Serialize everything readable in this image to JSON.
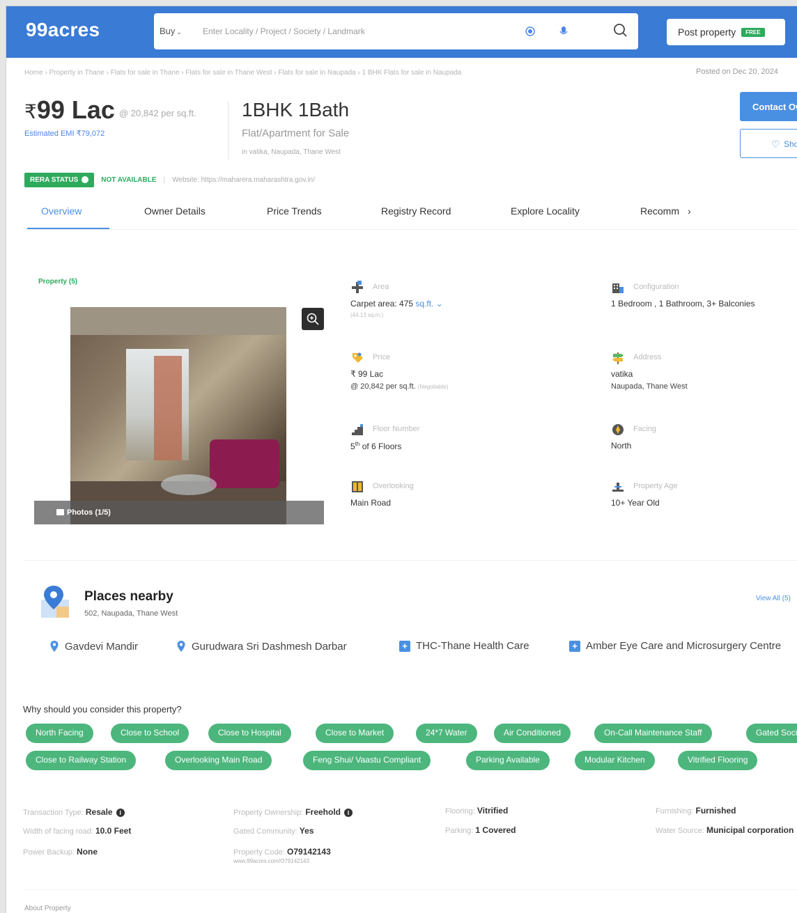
{
  "header": {
    "logo": "99acres",
    "buy_label": "Buy",
    "search_placeholder": "Enter Locality / Project / Society / Landmark",
    "post_property": "Post property",
    "free_badge": "FREE"
  },
  "breadcrumb": "Home › Property in Thane › Flats for sale in Thane › Flats for sale in Thane West › Flats for sale in Naupada › 1 BHK Flats for sale in Naupada",
  "posted_on": "Posted on Dec 20, 2024",
  "listing": {
    "price_symbol": "₹",
    "price": "99 Lac",
    "per_sqft": "@ 20,842 per sq.ft.",
    "emi": "Estimated EMI ₹79,072",
    "bhk": "1BHK 1Bath",
    "type": "Flat/Apartment for Sale",
    "location": "in vatika, Naupada, Thane West",
    "contact_btn": "Contact Owner",
    "shortlist_btn": "Shortlist"
  },
  "rera": {
    "badge": "RERA STATUS",
    "status": "NOT AVAILABLE",
    "separator": "|",
    "website": "Website: https://maharera.maharashtra.gov.in/"
  },
  "tabs": [
    "Overview",
    "Owner Details",
    "Price Trends",
    "Registry Record",
    "Explore Locality",
    "Recomm"
  ],
  "tabs_more": "›",
  "photos": {
    "label": "Property (5)",
    "caption": "Photos (1/5)"
  },
  "details": {
    "area": {
      "label": "Area",
      "value": "Carpet area: 475",
      "unit": "sq.ft.",
      "sub": "(44.13 sq.m.)"
    },
    "configuration": {
      "label": "Configuration",
      "value": "1 Bedroom , 1 Bathroom, 3+ Balconies"
    },
    "price": {
      "label": "Price",
      "value": "₹ 99 Lac",
      "sub": "@ 20,842 per sq.ft.",
      "negotiable": "(Negotiable)"
    },
    "address": {
      "label": "Address",
      "value": "vatika",
      "sub": "Naupada, Thane West"
    },
    "floor": {
      "label": "Floor Number",
      "value": "5",
      "sup": "th",
      "of_floors": "of 6 Floors"
    },
    "facing": {
      "label": "Facing",
      "value": "North"
    },
    "overlooking": {
      "label": "Overlooking",
      "value": "Main Road"
    },
    "age": {
      "label": "Property Age",
      "value": "10+ Year Old"
    }
  },
  "places": {
    "title": "Places nearby",
    "address": "502, Naupada, Thane West",
    "view_all": "View All (5)",
    "items": [
      {
        "name": "Gavdevi Mandir",
        "icon": "pin-icon"
      },
      {
        "name": "Gurudwara Sri Dashmesh Darbar",
        "icon": "pin-icon"
      },
      {
        "name": "THC-Thane Health Care",
        "icon": "hospital-icon"
      },
      {
        "name": "Amber Eye Care and Microsurgery Centre",
        "icon": "hospital-icon"
      }
    ]
  },
  "why": {
    "title": "Why should you consider this property?",
    "chips_row1": [
      "North Facing",
      "Close to School",
      "Close to Hospital",
      "Close to Market",
      "24*7 Water",
      "Air Conditioned",
      "On-Call Maintenance Staff",
      "Gated Society"
    ],
    "chips_row2": [
      "Close to Railway Station",
      "Overlooking Main Road",
      "Feng Shui/ Vaastu Compliant",
      "Parking Available",
      "Modular Kitchen",
      "Vitrified Flooring"
    ]
  },
  "facts": {
    "transaction_label": "Transaction Type:",
    "transaction": "Resale",
    "road_label": "Width of facing road:",
    "road": "10.0 Feet",
    "backup_label": "Power Backup:",
    "backup": "None",
    "ownership_label": "Property Ownership:",
    "ownership": "Freehold",
    "gated_label": "Gated Community:",
    "gated": "Yes",
    "code_label": "Property Code:",
    "code": "O79142143",
    "code_url": "www.99acres.com/O79142143",
    "flooring_label": "Flooring:",
    "flooring": "Vitrified",
    "parking_label": "Parking:",
    "parking": "1 Covered",
    "furnishing_label": "Furnishing:",
    "furnishing": "Furnished",
    "water_label": "Water Source:",
    "water": "Municipal corporation"
  },
  "about_label": "About Property",
  "colors": {
    "brand": "#3a7bd5",
    "accent": "#4a90e2",
    "green": "#2eaa5d",
    "chip": "#4cb67d"
  }
}
